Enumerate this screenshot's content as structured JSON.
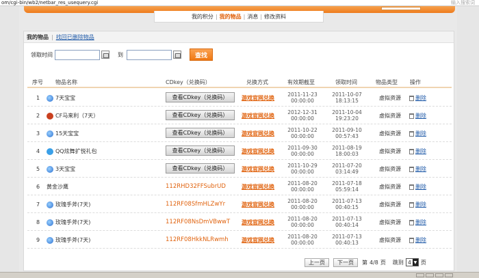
{
  "browser": {
    "url": "om/cgi-bin/wb2/netbar_res_usequery.cgi",
    "right_text": "输入搜索词"
  },
  "subnav": {
    "items": [
      "我的积分",
      "我的物品",
      "消息",
      "修改资料"
    ],
    "active_index": 1
  },
  "panel": {
    "title": "我的物品",
    "recover_link": "找回已删除物品"
  },
  "filter": {
    "claim_time_label": "领取时间",
    "start_value": "",
    "to_label": "到",
    "end_value": "",
    "search_label": "查找"
  },
  "table": {
    "headers": [
      "序号",
      "物品名称",
      "CDkey（兑换码）",
      "兑换方式",
      "有效期截至",
      "领取时间",
      "物品类型",
      "操作"
    ],
    "view_cdkey_label": "查看CDkey（兑换码）",
    "redeem_label": "游戏官网兑换",
    "delete_label": "删除",
    "rows": [
      {
        "num": "1",
        "icon": "ie-icon",
        "name": "7天宝宝",
        "cdkey": "",
        "expire_date": "2011-11-23",
        "expire_time": "00:00:00",
        "claim_date": "2011-10-07",
        "claim_time": "18:13:15",
        "type": "虚拟资源"
      },
      {
        "num": "2",
        "icon": "game-icon",
        "name": "CF马来利（7天）",
        "cdkey": "",
        "expire_date": "2012-12-31",
        "expire_time": "00:00:00",
        "claim_date": "2011-10-04",
        "claim_time": "19:23:20",
        "type": "虚拟资源"
      },
      {
        "num": "3",
        "icon": "ie-icon",
        "name": "15天宝宝",
        "cdkey": "",
        "expire_date": "2011-10-22",
        "expire_time": "00:00:00",
        "claim_date": "2011-09-10",
        "claim_time": "00:57:43",
        "type": "虚拟资源"
      },
      {
        "num": "4",
        "icon": "qq-icon",
        "name": "QQ炫舞扩悦礼包",
        "cdkey": "",
        "expire_date": "2011-09-30",
        "expire_time": "00:00:00",
        "claim_date": "2011-08-19",
        "claim_time": "18:00:03",
        "type": "虚拟资源"
      },
      {
        "num": "5",
        "icon": "ie-icon",
        "name": "3天宝宝",
        "cdkey": "",
        "expire_date": "2011-10-29",
        "expire_time": "00:00:00",
        "claim_date": "2011-07-20",
        "claim_time": "03:14:49",
        "type": "虚拟资源"
      },
      {
        "num": "6",
        "icon": "none",
        "name": "黄金沙鹰",
        "cdkey": "112RHD32FFSubrUD",
        "expire_date": "2011-08-20",
        "expire_time": "00:00:00",
        "claim_date": "2011-07-18",
        "claim_time": "05:59:14",
        "type": "虚拟资源"
      },
      {
        "num": "7",
        "icon": "ie-icon",
        "name": "玫瑰手斧(7天)",
        "cdkey": "112RF08SfmHLZwYr",
        "expire_date": "2011-08-20",
        "expire_time": "00:00:00",
        "claim_date": "2011-07-13",
        "claim_time": "00:40:15",
        "type": "虚拟资源"
      },
      {
        "num": "8",
        "icon": "ie-icon",
        "name": "玫瑰手斧(7天)",
        "cdkey": "112RF08NsDmVBwwT",
        "expire_date": "2011-08-20",
        "expire_time": "00:00:00",
        "claim_date": "2011-07-13",
        "claim_time": "00:40:14",
        "type": "虚拟资源"
      },
      {
        "num": "9",
        "icon": "ie-icon",
        "name": "玫瑰手斧(7天)",
        "cdkey": "112RF08HkkNLRwmh",
        "expire_date": "2011-08-20",
        "expire_time": "00:00:00",
        "claim_date": "2011-07-13",
        "claim_time": "00:40:13",
        "type": "虚拟资源"
      }
    ]
  },
  "pager": {
    "prev": "上一页",
    "next": "下一页",
    "page_info_prefix": "第",
    "current_page": "4",
    "total_pages": "8",
    "page_suffix": "页",
    "jump_label": "跳到",
    "jump_value": "4",
    "jump_suffix": "页"
  }
}
